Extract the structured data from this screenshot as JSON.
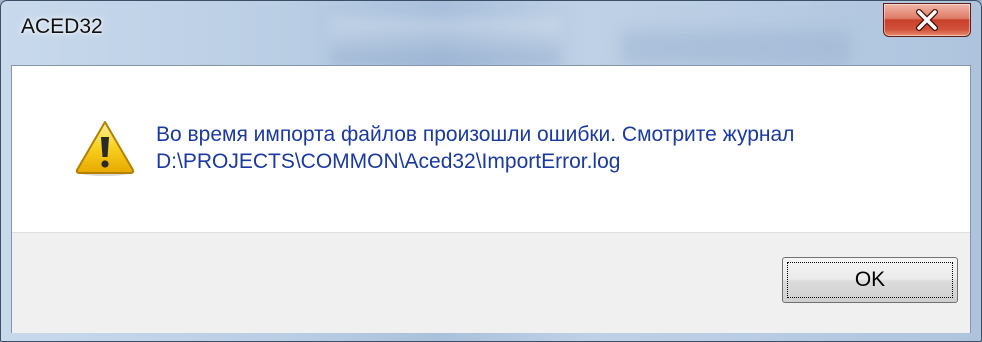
{
  "window": {
    "title": "ACED32"
  },
  "message": {
    "line1": "Во время импорта файлов произошли ошибки. Смотрите журнал",
    "line2": "D:\\PROJECTS\\COMMON\\Aced32\\ImportError.log"
  },
  "buttons": {
    "ok_label": "OK"
  },
  "icons": {
    "warning": "warning-icon",
    "close": "close-icon"
  },
  "colors": {
    "message_text": "#1a3aa0",
    "close_button": "#c8402a",
    "warning_yellow": "#f7d11f"
  }
}
